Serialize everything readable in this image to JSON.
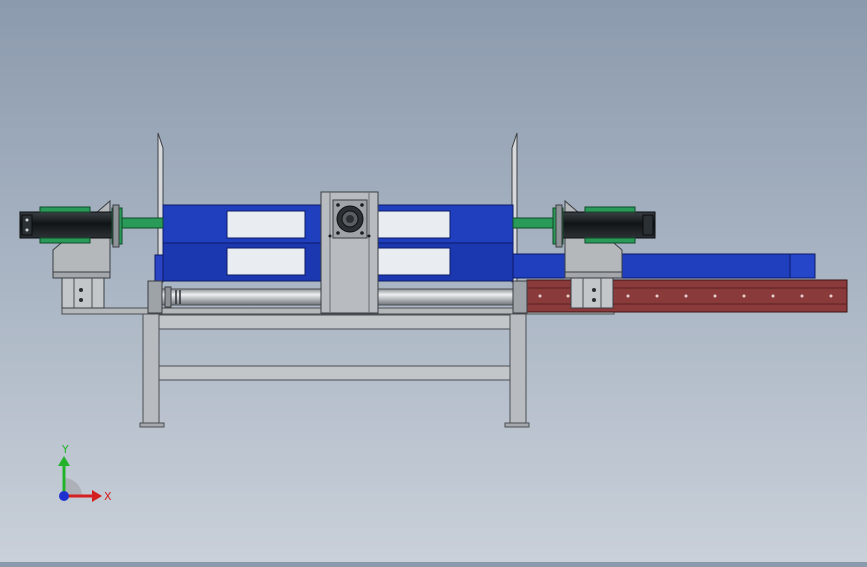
{
  "viewport": {
    "title": "",
    "background_top": "#8b9aad",
    "background_bottom": "#c9d0d9"
  },
  "model": {
    "parts": [
      "support-frame",
      "left-guide-plate",
      "right-guide-plate",
      "upper-blue-housing",
      "lower-blue-housing",
      "center-bearing-plate",
      "shaft-roller",
      "left-pneumatic-cylinder",
      "right-pneumatic-cylinder",
      "left-cylinder-bracket",
      "right-cylinder-bracket",
      "right-blue-rail",
      "right-red-base-beam"
    ],
    "colors": {
      "frame": "#b8bcc0",
      "housing_blue": "#1f3fbf",
      "bracket_gray": "#b5b8bb",
      "cylinder_dark": "#1e2226",
      "cylinder_green": "#2a9a58",
      "red_beam": "#8a3a3a",
      "shaft": "#cfd3d6"
    }
  },
  "triad": {
    "x_label": "X",
    "y_label": "Y",
    "x_color": "#d42020",
    "y_color": "#22b32a",
    "z_color": "#2030d0"
  }
}
